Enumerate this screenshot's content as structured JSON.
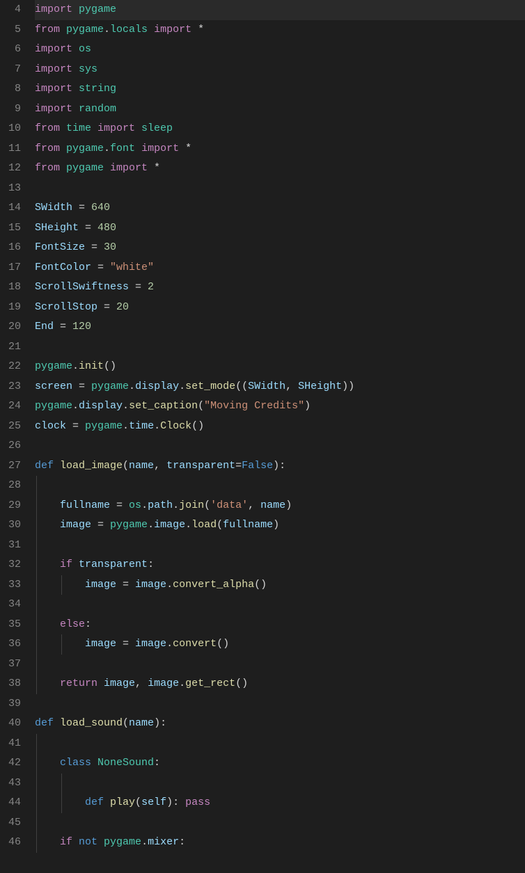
{
  "editor": {
    "language": "python",
    "activeLine": 4,
    "firstLineNumber": 4,
    "lines": [
      {
        "n": 4,
        "tokens": [
          {
            "t": "import ",
            "c": "kw-import"
          },
          {
            "t": "pygame",
            "c": "mod"
          }
        ]
      },
      {
        "n": 5,
        "tokens": [
          {
            "t": "from ",
            "c": "kw-import"
          },
          {
            "t": "pygame",
            "c": "mod"
          },
          {
            "t": ".",
            "c": "punct"
          },
          {
            "t": "locals",
            "c": "mod"
          },
          {
            "t": " import ",
            "c": "kw-import"
          },
          {
            "t": "*",
            "c": "op"
          }
        ]
      },
      {
        "n": 6,
        "tokens": [
          {
            "t": "import ",
            "c": "kw-import"
          },
          {
            "t": "os",
            "c": "mod"
          }
        ]
      },
      {
        "n": 7,
        "tokens": [
          {
            "t": "import ",
            "c": "kw-import"
          },
          {
            "t": "sys",
            "c": "mod"
          }
        ]
      },
      {
        "n": 8,
        "tokens": [
          {
            "t": "import ",
            "c": "kw-import"
          },
          {
            "t": "string",
            "c": "mod"
          }
        ]
      },
      {
        "n": 9,
        "tokens": [
          {
            "t": "import ",
            "c": "kw-import"
          },
          {
            "t": "random",
            "c": "mod"
          }
        ]
      },
      {
        "n": 10,
        "tokens": [
          {
            "t": "from ",
            "c": "kw-import"
          },
          {
            "t": "time",
            "c": "mod"
          },
          {
            "t": " import ",
            "c": "kw-import"
          },
          {
            "t": "sleep",
            "c": "mod"
          }
        ]
      },
      {
        "n": 11,
        "tokens": [
          {
            "t": "from ",
            "c": "kw-import"
          },
          {
            "t": "pygame",
            "c": "mod"
          },
          {
            "t": ".",
            "c": "punct"
          },
          {
            "t": "font",
            "c": "mod"
          },
          {
            "t": " import ",
            "c": "kw-import"
          },
          {
            "t": "*",
            "c": "op"
          }
        ]
      },
      {
        "n": 12,
        "tokens": [
          {
            "t": "from ",
            "c": "kw-import"
          },
          {
            "t": "pygame",
            "c": "mod"
          },
          {
            "t": " import ",
            "c": "kw-import"
          },
          {
            "t": "*",
            "c": "op"
          }
        ]
      },
      {
        "n": 13,
        "tokens": []
      },
      {
        "n": 14,
        "tokens": [
          {
            "t": "SWidth",
            "c": "var"
          },
          {
            "t": " = ",
            "c": "op"
          },
          {
            "t": "640",
            "c": "num"
          }
        ]
      },
      {
        "n": 15,
        "tokens": [
          {
            "t": "SHeight",
            "c": "var"
          },
          {
            "t": " = ",
            "c": "op"
          },
          {
            "t": "480",
            "c": "num"
          }
        ]
      },
      {
        "n": 16,
        "tokens": [
          {
            "t": "FontSize",
            "c": "var"
          },
          {
            "t": " = ",
            "c": "op"
          },
          {
            "t": "30",
            "c": "num"
          }
        ]
      },
      {
        "n": 17,
        "tokens": [
          {
            "t": "FontColor",
            "c": "var"
          },
          {
            "t": " = ",
            "c": "op"
          },
          {
            "t": "\"white\"",
            "c": "str"
          }
        ]
      },
      {
        "n": 18,
        "tokens": [
          {
            "t": "ScrollSwiftness",
            "c": "var"
          },
          {
            "t": " = ",
            "c": "op"
          },
          {
            "t": "2",
            "c": "num"
          }
        ]
      },
      {
        "n": 19,
        "tokens": [
          {
            "t": "ScrollStop",
            "c": "var"
          },
          {
            "t": " = ",
            "c": "op"
          },
          {
            "t": "20",
            "c": "num"
          }
        ]
      },
      {
        "n": 20,
        "tokens": [
          {
            "t": "End",
            "c": "var"
          },
          {
            "t": " = ",
            "c": "op"
          },
          {
            "t": "120",
            "c": "num"
          }
        ]
      },
      {
        "n": 21,
        "tokens": []
      },
      {
        "n": 22,
        "tokens": [
          {
            "t": "pygame",
            "c": "mod"
          },
          {
            "t": ".",
            "c": "punct"
          },
          {
            "t": "init",
            "c": "func"
          },
          {
            "t": "()",
            "c": "punct"
          }
        ]
      },
      {
        "n": 23,
        "tokens": [
          {
            "t": "screen",
            "c": "var"
          },
          {
            "t": " = ",
            "c": "op"
          },
          {
            "t": "pygame",
            "c": "mod"
          },
          {
            "t": ".",
            "c": "punct"
          },
          {
            "t": "display",
            "c": "var"
          },
          {
            "t": ".",
            "c": "punct"
          },
          {
            "t": "set_mode",
            "c": "func"
          },
          {
            "t": "((",
            "c": "punct"
          },
          {
            "t": "SWidth",
            "c": "var"
          },
          {
            "t": ", ",
            "c": "punct"
          },
          {
            "t": "SHeight",
            "c": "var"
          },
          {
            "t": "))",
            "c": "punct"
          }
        ]
      },
      {
        "n": 24,
        "tokens": [
          {
            "t": "pygame",
            "c": "mod"
          },
          {
            "t": ".",
            "c": "punct"
          },
          {
            "t": "display",
            "c": "var"
          },
          {
            "t": ".",
            "c": "punct"
          },
          {
            "t": "set_caption",
            "c": "func"
          },
          {
            "t": "(",
            "c": "punct"
          },
          {
            "t": "\"Moving Credits\"",
            "c": "str"
          },
          {
            "t": ")",
            "c": "punct"
          }
        ]
      },
      {
        "n": 25,
        "tokens": [
          {
            "t": "clock",
            "c": "var"
          },
          {
            "t": " = ",
            "c": "op"
          },
          {
            "t": "pygame",
            "c": "mod"
          },
          {
            "t": ".",
            "c": "punct"
          },
          {
            "t": "time",
            "c": "var"
          },
          {
            "t": ".",
            "c": "punct"
          },
          {
            "t": "Clock",
            "c": "func"
          },
          {
            "t": "()",
            "c": "punct"
          }
        ]
      },
      {
        "n": 26,
        "tokens": []
      },
      {
        "n": 27,
        "tokens": [
          {
            "t": "def ",
            "c": "kw-def"
          },
          {
            "t": "load_image",
            "c": "func"
          },
          {
            "t": "(",
            "c": "punct"
          },
          {
            "t": "name",
            "c": "var"
          },
          {
            "t": ", ",
            "c": "punct"
          },
          {
            "t": "transparent",
            "c": "var"
          },
          {
            "t": "=",
            "c": "op"
          },
          {
            "t": "False",
            "c": "const"
          },
          {
            "t": "):",
            "c": "punct"
          }
        ]
      },
      {
        "n": 28,
        "indent": 1,
        "tokens": []
      },
      {
        "n": 29,
        "indent": 1,
        "tokens": [
          {
            "t": "    ",
            "c": ""
          },
          {
            "t": "fullname",
            "c": "var"
          },
          {
            "t": " = ",
            "c": "op"
          },
          {
            "t": "os",
            "c": "mod"
          },
          {
            "t": ".",
            "c": "punct"
          },
          {
            "t": "path",
            "c": "var"
          },
          {
            "t": ".",
            "c": "punct"
          },
          {
            "t": "join",
            "c": "func"
          },
          {
            "t": "(",
            "c": "punct"
          },
          {
            "t": "'data'",
            "c": "str"
          },
          {
            "t": ", ",
            "c": "punct"
          },
          {
            "t": "name",
            "c": "var"
          },
          {
            "t": ")",
            "c": "punct"
          }
        ]
      },
      {
        "n": 30,
        "indent": 1,
        "tokens": [
          {
            "t": "    ",
            "c": ""
          },
          {
            "t": "image",
            "c": "var"
          },
          {
            "t": " = ",
            "c": "op"
          },
          {
            "t": "pygame",
            "c": "mod"
          },
          {
            "t": ".",
            "c": "punct"
          },
          {
            "t": "image",
            "c": "var"
          },
          {
            "t": ".",
            "c": "punct"
          },
          {
            "t": "load",
            "c": "func"
          },
          {
            "t": "(",
            "c": "punct"
          },
          {
            "t": "fullname",
            "c": "var"
          },
          {
            "t": ")",
            "c": "punct"
          }
        ]
      },
      {
        "n": 31,
        "indent": 1,
        "tokens": []
      },
      {
        "n": 32,
        "indent": 1,
        "tokens": [
          {
            "t": "    ",
            "c": ""
          },
          {
            "t": "if ",
            "c": "kw-ctrl"
          },
          {
            "t": "transparent",
            "c": "var"
          },
          {
            "t": ":",
            "c": "punct"
          }
        ]
      },
      {
        "n": 33,
        "indent": 2,
        "tokens": [
          {
            "t": "        ",
            "c": ""
          },
          {
            "t": "image",
            "c": "var"
          },
          {
            "t": " = ",
            "c": "op"
          },
          {
            "t": "image",
            "c": "var"
          },
          {
            "t": ".",
            "c": "punct"
          },
          {
            "t": "convert_alpha",
            "c": "func"
          },
          {
            "t": "()",
            "c": "punct"
          }
        ]
      },
      {
        "n": 34,
        "indent": 1,
        "tokens": []
      },
      {
        "n": 35,
        "indent": 1,
        "tokens": [
          {
            "t": "    ",
            "c": ""
          },
          {
            "t": "else",
            "c": "kw-ctrl"
          },
          {
            "t": ":",
            "c": "punct"
          }
        ]
      },
      {
        "n": 36,
        "indent": 2,
        "tokens": [
          {
            "t": "        ",
            "c": ""
          },
          {
            "t": "image",
            "c": "var"
          },
          {
            "t": " = ",
            "c": "op"
          },
          {
            "t": "image",
            "c": "var"
          },
          {
            "t": ".",
            "c": "punct"
          },
          {
            "t": "convert",
            "c": "func"
          },
          {
            "t": "()",
            "c": "punct"
          }
        ]
      },
      {
        "n": 37,
        "indent": 1,
        "tokens": []
      },
      {
        "n": 38,
        "indent": 1,
        "tokens": [
          {
            "t": "    ",
            "c": ""
          },
          {
            "t": "return ",
            "c": "kw-ctrl"
          },
          {
            "t": "image",
            "c": "var"
          },
          {
            "t": ", ",
            "c": "punct"
          },
          {
            "t": "image",
            "c": "var"
          },
          {
            "t": ".",
            "c": "punct"
          },
          {
            "t": "get_rect",
            "c": "func"
          },
          {
            "t": "()",
            "c": "punct"
          }
        ]
      },
      {
        "n": 39,
        "tokens": []
      },
      {
        "n": 40,
        "tokens": [
          {
            "t": "def ",
            "c": "kw-def"
          },
          {
            "t": "load_sound",
            "c": "func"
          },
          {
            "t": "(",
            "c": "punct"
          },
          {
            "t": "name",
            "c": "var"
          },
          {
            "t": "):",
            "c": "punct"
          }
        ]
      },
      {
        "n": 41,
        "indent": 1,
        "tokens": []
      },
      {
        "n": 42,
        "indent": 1,
        "tokens": [
          {
            "t": "    ",
            "c": ""
          },
          {
            "t": "class ",
            "c": "kw-def"
          },
          {
            "t": "NoneSound",
            "c": "mod"
          },
          {
            "t": ":",
            "c": "punct"
          }
        ]
      },
      {
        "n": 43,
        "indent": 2,
        "tokens": []
      },
      {
        "n": 44,
        "indent": 2,
        "tokens": [
          {
            "t": "        ",
            "c": ""
          },
          {
            "t": "def ",
            "c": "kw-def"
          },
          {
            "t": "play",
            "c": "func"
          },
          {
            "t": "(",
            "c": "punct"
          },
          {
            "t": "self",
            "c": "var"
          },
          {
            "t": "): ",
            "c": "punct"
          },
          {
            "t": "pass",
            "c": "kw-ctrl"
          }
        ]
      },
      {
        "n": 45,
        "indent": 1,
        "tokens": []
      },
      {
        "n": 46,
        "indent": 1,
        "tokens": [
          {
            "t": "    ",
            "c": ""
          },
          {
            "t": "if ",
            "c": "kw-ctrl"
          },
          {
            "t": "not ",
            "c": "kw-def"
          },
          {
            "t": "pygame",
            "c": "mod"
          },
          {
            "t": ".",
            "c": "punct"
          },
          {
            "t": "mixer",
            "c": "var"
          },
          {
            "t": ":",
            "c": "punct"
          }
        ]
      }
    ]
  }
}
